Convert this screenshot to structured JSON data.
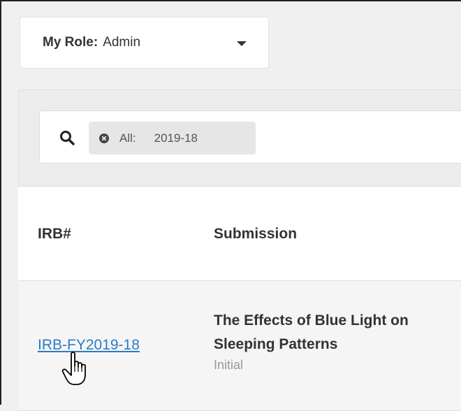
{
  "role_selector": {
    "label": "My Role:",
    "value": "Admin",
    "icon": "caret-down-icon"
  },
  "search": {
    "icon": "search-icon",
    "filter_chip": {
      "remove_icon": "close-circle-icon",
      "key": "All:",
      "value": "2019-18"
    }
  },
  "table": {
    "columns": [
      "IRB#",
      "Submission"
    ],
    "rows": [
      {
        "irb": "IRB-FY2019-18",
        "submission_title": "The Effects of Blue Light on Sleeping Patterns",
        "submission_type": "Initial"
      }
    ]
  },
  "colors": {
    "link": "#2a7cc7",
    "panel_bg": "#ececec",
    "muted_text": "#999999"
  },
  "cursor": "hand-pointer-icon"
}
